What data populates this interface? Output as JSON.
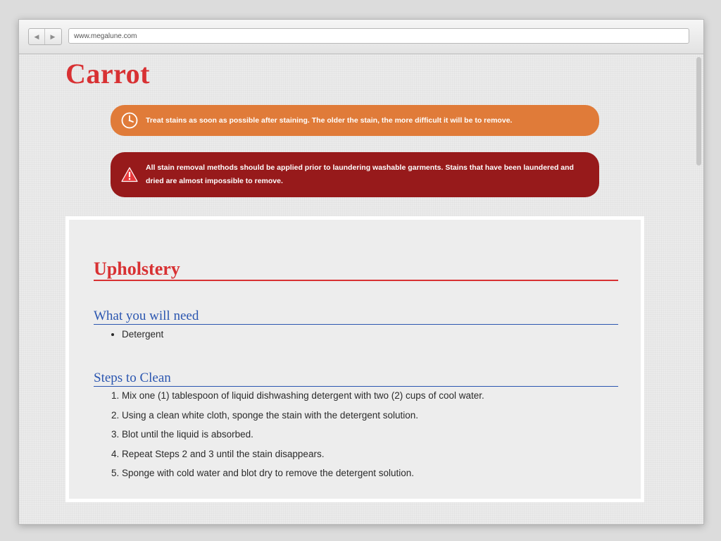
{
  "browser": {
    "url": "www.megalune.com",
    "back_glyph": "◀",
    "forward_glyph": "▶"
  },
  "page": {
    "title": "Carrot",
    "alerts": {
      "tip": {
        "icon": "clock-icon",
        "text": "Treat stains as soon as possible after staining. The older the stain, the more difficult it will be to remove.",
        "color": "#e07b39"
      },
      "warning": {
        "icon": "warning-icon",
        "text": "All stain removal methods should be applied prior to laundering washable garments. Stains that have been laundered and dried are almost impossible to remove.",
        "color": "#971a1b"
      }
    },
    "section": {
      "title": "Upholstery",
      "needs_heading": "What you will need",
      "needs": [
        "Detergent"
      ],
      "steps_heading": "Steps to Clean",
      "steps": [
        "Mix one (1) tablespoon of liquid dishwashing detergent with two (2) cups of cool water.",
        "Using a clean white cloth, sponge the stain with the detergent solution.",
        "Blot until the liquid is absorbed.",
        "Repeat Steps 2 and 3 until the stain disappears.",
        "Sponge with cold water and blot dry to remove the detergent solution."
      ]
    }
  },
  "colors": {
    "title_red": "#d83133",
    "heading_blue": "#2b56b0"
  }
}
